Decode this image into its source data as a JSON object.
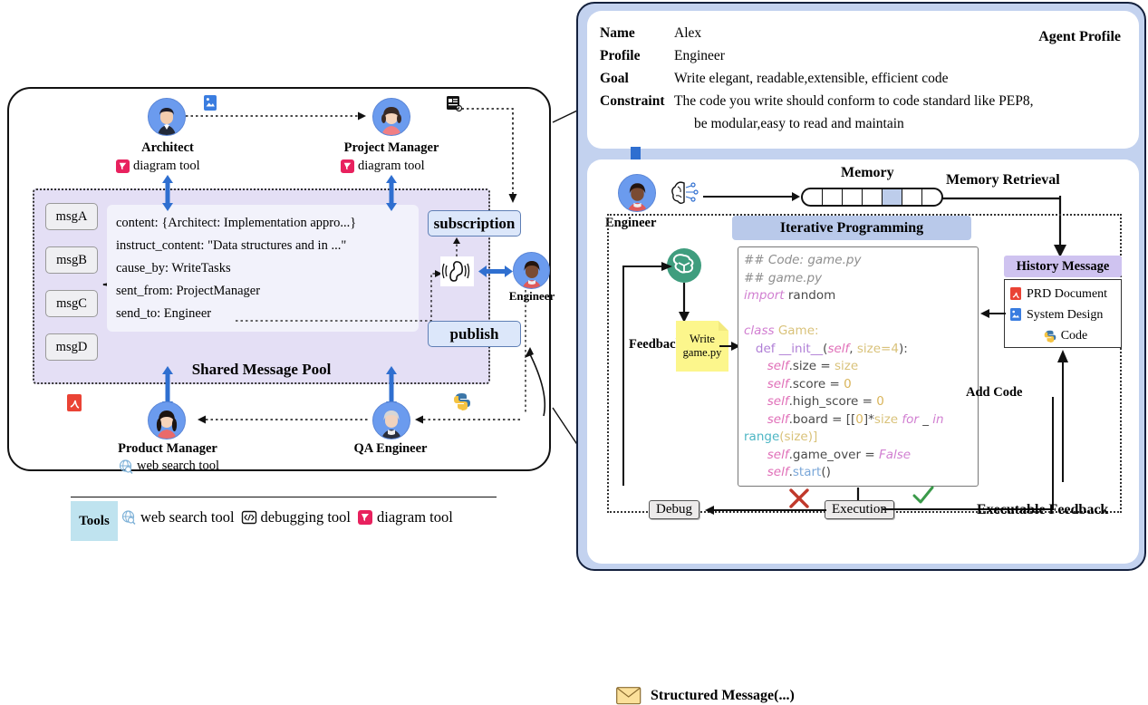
{
  "left_panel": {
    "roles": [
      {
        "id": "architect",
        "name": "Architect",
        "tool": "diagram tool",
        "tool_icon": "diagram-tool-icon"
      },
      {
        "id": "project-manager",
        "name": "Project Manager",
        "tool": "diagram tool",
        "tool_icon": "diagram-tool-icon"
      },
      {
        "id": "engineer",
        "name": "Engineer",
        "tool": "",
        "tool_icon": ""
      },
      {
        "id": "product-manager",
        "name": "Product Manager",
        "tool": "web search tool",
        "tool_icon": "web-search-tool-icon"
      },
      {
        "id": "qa-engineer",
        "name": "QA Engineer",
        "tool": "",
        "tool_icon": ""
      }
    ],
    "message_pool": {
      "title": "Shared Message Pool",
      "chips": [
        "msgA",
        "msgB",
        "msgC",
        "msgD"
      ],
      "content_lines": [
        "content: {Architect: Implementation appro...}",
        "instruct_content: \"Data structures and in ...\"",
        "cause_by: WriteTasks",
        "sent_from: ProjectManager",
        "send_to: Engineer"
      ]
    },
    "subscription_label": "subscription",
    "publish_label": "publish",
    "artifact_icons": [
      "image-file-icon",
      "document-file-icon",
      "pdf-file-icon",
      "python-file-icon"
    ],
    "listen_icon": "listening-ear-icon",
    "tools_legend": {
      "badge": "Tools",
      "items": [
        {
          "icon": "web-search-tool-icon",
          "label": "web search tool"
        },
        {
          "icon": "debugging-tool-icon",
          "label": "debugging tool"
        },
        {
          "icon": "diagram-tool-icon",
          "label": "diagram tool"
        }
      ]
    }
  },
  "right_panel": {
    "profile": {
      "title": "Agent Profile",
      "rows": [
        {
          "label": "Name",
          "value": "Alex"
        },
        {
          "label": "Profile",
          "value": "Engineer"
        },
        {
          "label": "Goal",
          "value": "Write elegant, readable,extensible, efficient code"
        },
        {
          "label": "Constraint",
          "value": "The code you write should conform to code standard like PEP8,"
        },
        {
          "label": "",
          "value": "be modular,easy to read and maintain"
        }
      ]
    },
    "agent_name": "Engineer",
    "brain_icon": "brain-memory-icon",
    "memory": {
      "label": "Memory",
      "cells": 7,
      "active_index": 4,
      "retrieval_label": "Memory Retrieval"
    },
    "iterative": {
      "title": "Iterative Programming",
      "llm_icon": "openai-logo-icon",
      "sticky_note": "Write\ngame.py",
      "sticky_line1": "Write",
      "sticky_line2": "game.py",
      "feedback_label": "Feedback",
      "add_code_label": "Add Code",
      "debug_label": "Debug",
      "execution_label": "Execution",
      "executable_feedback_label": "Executable Feedback",
      "fail_icon": "cross-mark-icon",
      "pass_icon": "check-mark-icon",
      "code_lines": [
        [
          {
            "t": "## Code: game.py",
            "c": "k-comment"
          }
        ],
        [
          {
            "t": "## game.py",
            "c": "k-comment"
          }
        ],
        [
          {
            "t": "import ",
            "c": "k-kw"
          },
          {
            "t": "random",
            "c": "k-plain"
          }
        ],
        [
          {
            "t": " ",
            "c": "k-plain"
          }
        ],
        [
          {
            "t": "class ",
            "c": "k-kw"
          },
          {
            "t": "Game:",
            "c": "k-cls"
          }
        ],
        [
          {
            "t": "   def ",
            "c": "k-def"
          },
          {
            "t": "__init__",
            "c": "k-def"
          },
          {
            "t": "(",
            "c": "k-plain"
          },
          {
            "t": "self",
            "c": "k-self"
          },
          {
            "t": ", ",
            "c": "k-plain"
          },
          {
            "t": "size=4",
            "c": "k-cls"
          },
          {
            "t": "):",
            "c": "k-plain"
          }
        ],
        [
          {
            "t": "      ",
            "c": "k-plain"
          },
          {
            "t": "self",
            "c": "k-self"
          },
          {
            "t": ".size = ",
            "c": "k-plain"
          },
          {
            "t": "size",
            "c": "k-cls"
          }
        ],
        [
          {
            "t": "      ",
            "c": "k-plain"
          },
          {
            "t": "self",
            "c": "k-self"
          },
          {
            "t": ".score = ",
            "c": "k-plain"
          },
          {
            "t": "0",
            "c": "k-num"
          }
        ],
        [
          {
            "t": "      ",
            "c": "k-plain"
          },
          {
            "t": "self",
            "c": "k-self"
          },
          {
            "t": ".high_score = ",
            "c": "k-plain"
          },
          {
            "t": "0",
            "c": "k-num"
          }
        ],
        [
          {
            "t": "      ",
            "c": "k-plain"
          },
          {
            "t": "self",
            "c": "k-self"
          },
          {
            "t": ".board = [[",
            "c": "k-plain"
          },
          {
            "t": "0",
            "c": "k-num"
          },
          {
            "t": "]*",
            "c": "k-plain"
          },
          {
            "t": "size ",
            "c": "k-cls"
          },
          {
            "t": "for ",
            "c": "k-kw"
          },
          {
            "t": "_ ",
            "c": "k-plain"
          },
          {
            "t": "in",
            "c": "k-kw"
          }
        ],
        [
          {
            "t": "range",
            "c": "k-fn"
          },
          {
            "t": "(size)]",
            "c": "k-cls"
          }
        ],
        [
          {
            "t": "      ",
            "c": "k-plain"
          },
          {
            "t": "self",
            "c": "k-self"
          },
          {
            "t": ".game_over = ",
            "c": "k-plain"
          },
          {
            "t": "False",
            "c": "k-kw"
          }
        ],
        [
          {
            "t": "      ",
            "c": "k-plain"
          },
          {
            "t": "self",
            "c": "k-self"
          },
          {
            "t": ".",
            "c": "k-plain"
          },
          {
            "t": "start",
            "c": "k-attr"
          },
          {
            "t": "()",
            "c": "k-plain"
          }
        ]
      ]
    },
    "history": {
      "title": "History Message",
      "items": [
        {
          "icon": "pdf-file-icon",
          "label": "PRD Document"
        },
        {
          "icon": "image-file-icon",
          "label": "System Design"
        },
        {
          "icon": "python-file-icon",
          "label": "Code"
        }
      ]
    },
    "structured_message": {
      "icon": "envelope-icon",
      "label": "Structured Message(...)"
    }
  },
  "colors": {
    "panel_bg": "#c3d2ef",
    "pool_bg": "#e4dff5",
    "pubsub_bg": "#dce7fa",
    "iter_title_bg": "#b9c9ea",
    "history_title_bg": "#cfc3f0",
    "avatar_bg": "#6b9bee",
    "arrow_blue": "#2f6fd0",
    "sticky_yellow": "#fcf68c",
    "tools_badge": "#bfe3ef",
    "check_green": "#3a9a4a",
    "cross_red": "#c0392b"
  }
}
